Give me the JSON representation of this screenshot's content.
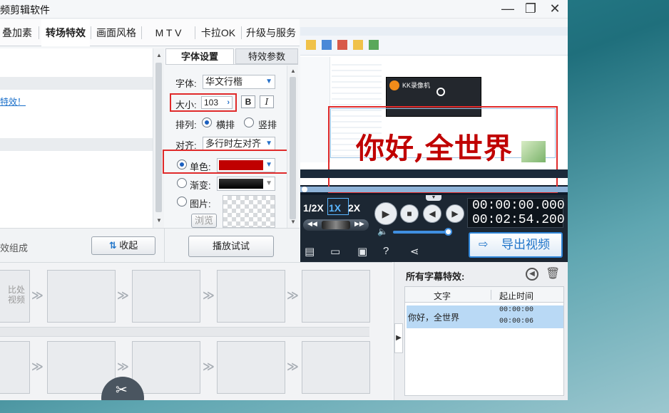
{
  "window": {
    "title": "视频剪辑软件",
    "title_visible": "频剪辑软件",
    "controls": {
      "minimize": "—",
      "maximize": "❐",
      "close": "✕"
    }
  },
  "tabs": [
    {
      "label": "叠加素材",
      "active": false
    },
    {
      "label": "转场特效",
      "active": true
    },
    {
      "label": "画面风格",
      "active": false
    },
    {
      "label": "M T V",
      "active": false
    },
    {
      "label": "卡拉OK",
      "active": false
    },
    {
      "label": "升级与服务",
      "active": false
    }
  ],
  "left_panel": {
    "link_text": "特效！"
  },
  "bottom_strip": {
    "compose_text": "效组成",
    "collapse_label": "收起",
    "play_test_label": "播放试试"
  },
  "font_settings": {
    "tab_font": "字体设置",
    "tab_effect": "特效参数",
    "font_label": "字体:",
    "font_value": "华文行楷",
    "size_label": "大小:",
    "size_value": "103",
    "bold": "B",
    "italic": "I",
    "layout_label": "排列:",
    "layout_horizontal": "横排",
    "layout_vertical": "竖排",
    "layout_selected": "横排",
    "align_label": "对齐:",
    "align_value": "多行时左对齐",
    "solid_label": "单色:",
    "solid_color": "#c00000",
    "gradient_label": "渐变:",
    "image_label": "图片:",
    "browse_label": "浏览",
    "fill_selected": "单色"
  },
  "preview": {
    "overlay_text": "你好,全世界",
    "recorder_label": "KK录像机"
  },
  "player": {
    "speed_half": "1/2X",
    "speed_1x": "1X",
    "speed_2x": "2X",
    "time_current": "00:00:00.000",
    "time_total": "00:02:54.200",
    "export_label": "导出视频"
  },
  "timeline": {
    "placeholder_text": "比处\n视频"
  },
  "subtitles": {
    "title": "所有字幕特效:",
    "col_text": "文字",
    "col_time": "起止时间",
    "rows": [
      {
        "text": "你好，全世界",
        "start": "00:00:00",
        "end": "00:00:06"
      }
    ]
  },
  "colors": {
    "accent_blue": "#1f74c9",
    "highlight_red": "#e02a2a",
    "subtitle_red": "#c00000",
    "row_selected": "#b9d9f5"
  }
}
